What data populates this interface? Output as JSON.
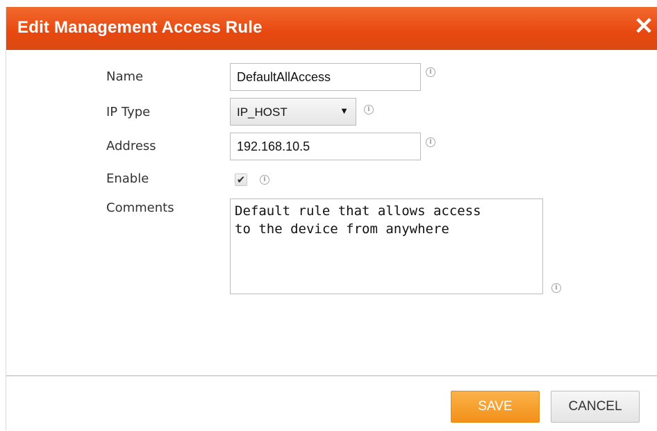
{
  "dialog": {
    "title": "Edit Management Access Rule",
    "close_symbol": "✕",
    "close_icon": "close-icon"
  },
  "form": {
    "name": {
      "label": "Name",
      "value": "DefaultAllAccess"
    },
    "ip_type": {
      "label": "IP Type",
      "value": "IP_HOST",
      "arrow": "▼"
    },
    "address": {
      "label": "Address",
      "value": "192.168.10.5"
    },
    "enable": {
      "label": "Enable",
      "checked": true,
      "check_mark": "✔"
    },
    "comments": {
      "label": "Comments",
      "value": "Default rule that allows access\nto the device from anywhere"
    },
    "info_symbol": "i",
    "info_icon": "info-icon"
  },
  "footer": {
    "save_label": "SAVE",
    "cancel_label": "CANCEL"
  },
  "colors": {
    "title_bar": "#e8480f",
    "save_button": "#f39019",
    "footer_border": "#f0a36f"
  }
}
